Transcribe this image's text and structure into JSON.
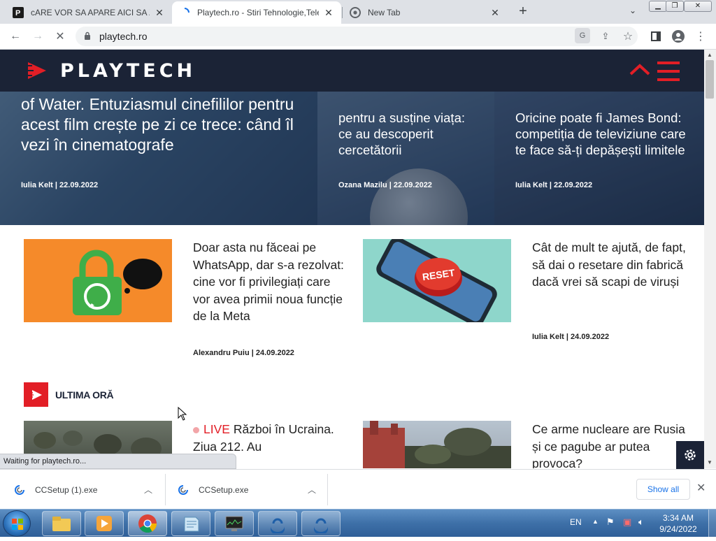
{
  "browser": {
    "tabs": [
      {
        "title": "cARE VOR SA APARE AICI SA ZIC",
        "favicon": "playtech-p-icon",
        "active": false
      },
      {
        "title": "Playtech.ro - Stiri Tehnologie,Tele",
        "favicon": "loading-spinner-icon",
        "active": true
      },
      {
        "title": "New Tab",
        "favicon": "chrome-icon",
        "active": false
      }
    ],
    "new_tab_label": "+",
    "url": "playtech.ro",
    "status_text": "Waiting for playtech.ro..."
  },
  "site": {
    "logo_text": "PLAYTECH",
    "hero": [
      {
        "title": "of Water. Entuziasmul cinefililor pentru acest film crește pe zi ce trece: când îl vezi în cinematografe",
        "meta": "Iulia Kelt | 22.09.2022"
      },
      {
        "title": "pentru a susține viața: ce au descoperit cercetătorii",
        "meta": "Ozana Mazilu | 22.09.2022"
      },
      {
        "title": "Oricine poate fi James Bond: competiția de televiziune care te face să-ți depășești limitele",
        "meta": "Iulia Kelt | 22.09.2022"
      }
    ],
    "cards": [
      {
        "title": "Doar asta nu făceai pe WhatsApp, dar s-a rezolvat: cine vor fi privilegiați care vor avea primii noua funcție de la Meta",
        "meta": "Alexandru Puiu | 24.09.2022"
      },
      {
        "title": "Cât de mult te ajută, de fapt, să dai o resetare din fabrică dacă vrei să scapi de viruși",
        "meta": "Iulia Kelt | 24.09.2022"
      }
    ],
    "section_title": "ULTIMA ORĂ",
    "latest": [
      {
        "live": "LIVE",
        "title": "Război în Ucraina. Ziua 212. Au"
      },
      {
        "title": "Ce arme nucleare are Rusia și ce pagube ar putea provoca?"
      }
    ],
    "reset_label": "RESET"
  },
  "downloads": {
    "items": [
      {
        "name": "CCSetup (1).exe"
      },
      {
        "name": "CCSetup.exe"
      }
    ],
    "show_all": "Show all"
  },
  "taskbar": {
    "language": "EN",
    "time": "3:34 AM",
    "date": "9/24/2022"
  },
  "colors": {
    "brand_dark": "#1b2336",
    "brand_red": "#e21e26"
  }
}
